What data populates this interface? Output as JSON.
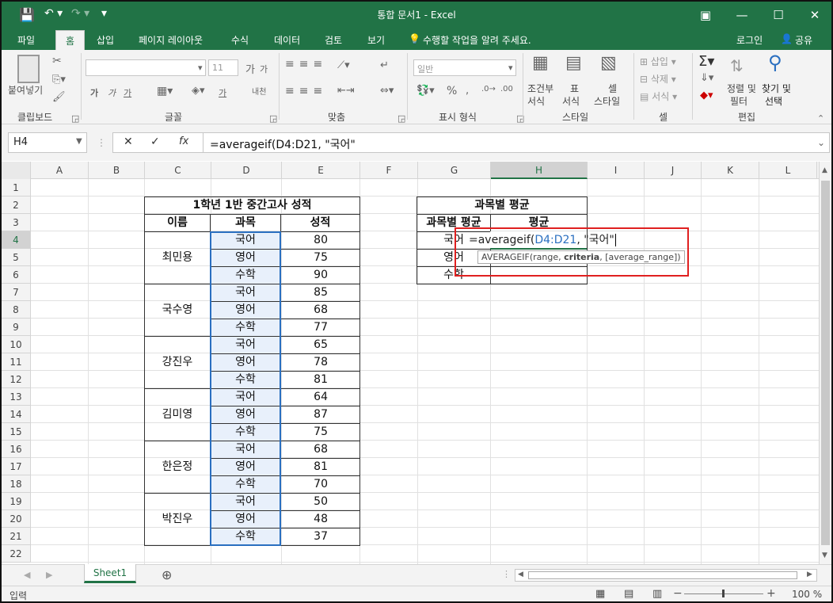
{
  "window": {
    "title": "통합 문서1 - Excel"
  },
  "tabs": [
    "파일",
    "홈",
    "삽입",
    "페이지 레이아웃",
    "수식",
    "데이터",
    "검토",
    "보기"
  ],
  "tell_me": "수행할 작업을 알려 주세요.",
  "account": {
    "login": "로그인",
    "share": "공유"
  },
  "ribbon": {
    "clipboard": {
      "paste": "붙여넣기",
      "label": "클립보드"
    },
    "font": {
      "size": "11",
      "label": "글꼴",
      "bold": "가",
      "italic": "가",
      "underline": "가",
      "grow": "가",
      "shrink": "가",
      "fontcolor": "가",
      "phonetic": "내천"
    },
    "align": {
      "label": "맞춤"
    },
    "number": {
      "format": "일반",
      "label": "표시 형식",
      "percent": "%"
    },
    "styles": {
      "cond1": "조건부",
      "cond2": "서식",
      "table1": "표",
      "table2": "서식",
      "cell1": "셀",
      "cell2": "스타일",
      "label": "스타일"
    },
    "cells": {
      "insert": "삽입",
      "delete": "삭제",
      "format": "서식",
      "label": "셀"
    },
    "editing": {
      "sort1": "정렬 및",
      "sort2": "필터",
      "find1": "찾기 및",
      "find2": "선택",
      "label": "편집"
    }
  },
  "formula_bar": {
    "name_box": "H4",
    "fx": "fx",
    "formula": "=averageif(D4:D21, \"국어\""
  },
  "columns": [
    "A",
    "B",
    "C",
    "D",
    "E",
    "F",
    "G",
    "H",
    "I",
    "J",
    "K",
    "L"
  ],
  "rows": [
    "1",
    "2",
    "3",
    "4",
    "5",
    "6",
    "7",
    "8",
    "9",
    "10",
    "11",
    "12",
    "13",
    "14",
    "15",
    "16",
    "17",
    "18",
    "19",
    "20",
    "21",
    "22"
  ],
  "table1": {
    "title": "1학년 1반 중간고사 성적",
    "headers": [
      "이름",
      "과목",
      "성적"
    ],
    "students": [
      "최민용",
      "국수영",
      "강진우",
      "김미영",
      "한은정",
      "박진우"
    ],
    "subjects": [
      "국어",
      "영어",
      "수학",
      "국어",
      "영어",
      "수학",
      "국어",
      "영어",
      "수학",
      "국어",
      "영어",
      "수학",
      "국어",
      "영어",
      "수학",
      "국어",
      "영어",
      "수학"
    ],
    "scores": [
      "80",
      "75",
      "90",
      "85",
      "68",
      "77",
      "65",
      "78",
      "81",
      "64",
      "87",
      "75",
      "68",
      "81",
      "70",
      "50",
      "48",
      "37"
    ]
  },
  "table2": {
    "title": "과목별 평균",
    "headers": [
      "과목별 평균",
      "평균"
    ],
    "rows": [
      "국어",
      "영어",
      "수학"
    ]
  },
  "edit": {
    "prefix": "=averageif(",
    "ref": "D4:D21",
    "suffix": ", \"국어\"",
    "tooltip_fn": "AVERAGEIF(range, ",
    "tooltip_bold": "criteria",
    "tooltip_rest": ", [average_range])"
  },
  "sheets": [
    "Sheet1"
  ],
  "status": {
    "mode": "입력",
    "zoom": "100 %"
  }
}
